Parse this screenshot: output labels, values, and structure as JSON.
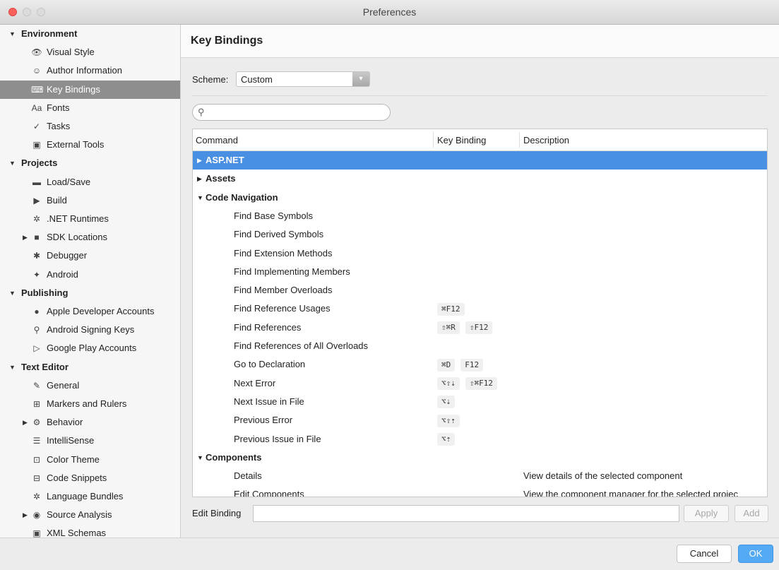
{
  "window": {
    "title": "Preferences"
  },
  "sidebar": {
    "groups": [
      {
        "label": "Environment",
        "items": [
          {
            "label": "Visual Style",
            "icon": "eye-icon",
            "glyph": "👁"
          },
          {
            "label": "Author Information",
            "icon": "smiley-icon",
            "glyph": "☺"
          },
          {
            "label": "Key Bindings",
            "icon": "keyboard-icon",
            "glyph": "⌨",
            "selected": true
          },
          {
            "label": "Fonts",
            "icon": "fonts-icon",
            "glyph": "Aa"
          },
          {
            "label": "Tasks",
            "icon": "checkmark-icon",
            "glyph": "✓"
          },
          {
            "label": "External Tools",
            "icon": "terminal-icon",
            "glyph": "▣"
          }
        ]
      },
      {
        "label": "Projects",
        "items": [
          {
            "label": "Load/Save",
            "icon": "drive-icon",
            "glyph": "▬"
          },
          {
            "label": "Build",
            "icon": "build-icon",
            "glyph": "▶"
          },
          {
            "label": ".NET Runtimes",
            "icon": "gear-icon",
            "glyph": "✲"
          },
          {
            "label": "SDK Locations",
            "icon": "folder-icon",
            "glyph": "■",
            "expandable": true
          },
          {
            "label": "Debugger",
            "icon": "bug-icon",
            "glyph": "✱"
          },
          {
            "label": "Android",
            "icon": "android-icon",
            "glyph": "✦"
          }
        ]
      },
      {
        "label": "Publishing",
        "items": [
          {
            "label": "Apple Developer Accounts",
            "icon": "apple-icon",
            "glyph": "●"
          },
          {
            "label": "Android Signing Keys",
            "icon": "key-search-icon",
            "glyph": "⚲"
          },
          {
            "label": "Google Play Accounts",
            "icon": "play-icon",
            "glyph": "▷"
          }
        ]
      },
      {
        "label": "Text Editor",
        "items": [
          {
            "label": "General",
            "icon": "edit-icon",
            "glyph": "✎"
          },
          {
            "label": "Markers and Rulers",
            "icon": "grid-icon",
            "glyph": "⊞"
          },
          {
            "label": "Behavior",
            "icon": "behavior-gear-icon",
            "glyph": "⚙",
            "expandable": true
          },
          {
            "label": "IntelliSense",
            "icon": "list-icon",
            "glyph": "☰"
          },
          {
            "label": "Color Theme",
            "icon": "palette-icon",
            "glyph": "⊡"
          },
          {
            "label": "Code Snippets",
            "icon": "snippet-icon",
            "glyph": "⊟"
          },
          {
            "label": "Language Bundles",
            "icon": "bundle-gear-icon",
            "glyph": "✲"
          },
          {
            "label": "Source Analysis",
            "icon": "radio-icon",
            "glyph": "◉",
            "expandable": true
          },
          {
            "label": "XML Schemas",
            "icon": "xml-icon",
            "glyph": "▣"
          }
        ]
      }
    ]
  },
  "main": {
    "title": "Key Bindings",
    "scheme_label": "Scheme:",
    "scheme_value": "Custom",
    "table": {
      "columns": [
        "Command",
        "Key Binding",
        "Description"
      ],
      "rows": [
        {
          "type": "group",
          "label": "ASP.NET",
          "expanded": false,
          "selected": true
        },
        {
          "type": "group",
          "label": "Assets",
          "expanded": false
        },
        {
          "type": "group",
          "label": "Code Navigation",
          "expanded": true
        },
        {
          "type": "child",
          "label": "Find Base Symbols",
          "keys": []
        },
        {
          "type": "child",
          "label": "Find Derived Symbols",
          "keys": []
        },
        {
          "type": "child",
          "label": "Find Extension Methods",
          "keys": []
        },
        {
          "type": "child",
          "label": "Find Implementing Members",
          "keys": []
        },
        {
          "type": "child",
          "label": "Find Member Overloads",
          "keys": []
        },
        {
          "type": "child",
          "label": "Find Reference Usages",
          "keys": [
            "⌘F12"
          ]
        },
        {
          "type": "child",
          "label": "Find References",
          "keys": [
            "⇧⌘R",
            "⇧F12"
          ]
        },
        {
          "type": "child",
          "label": "Find References of All Overloads",
          "keys": []
        },
        {
          "type": "child",
          "label": "Go to Declaration",
          "keys": [
            "⌘D",
            "F12"
          ]
        },
        {
          "type": "child",
          "label": "Next Error",
          "keys": [
            "⌥⇧⇣",
            "⇧⌘F12"
          ]
        },
        {
          "type": "child",
          "label": "Next Issue in File",
          "keys": [
            "⌥⇣"
          ]
        },
        {
          "type": "child",
          "label": "Previous Error",
          "keys": [
            "⌥⇧⇡"
          ]
        },
        {
          "type": "child",
          "label": "Previous Issue in File",
          "keys": [
            "⌥⇡"
          ]
        },
        {
          "type": "group",
          "label": "Components",
          "expanded": true
        },
        {
          "type": "child",
          "label": "Details",
          "keys": [],
          "description": "View details of the selected component"
        },
        {
          "type": "child",
          "label": "Edit Components",
          "keys": [],
          "description": "View the component manager for the selected projec"
        }
      ]
    },
    "edit_binding_label": "Edit Binding",
    "apply_label": "Apply",
    "add_label": "Add"
  },
  "footer": {
    "cancel_label": "Cancel",
    "ok_label": "OK"
  },
  "colors": {
    "selection": "#4a90e2",
    "ok_button": "#55aaf5",
    "sidebar_selected": "#8e8e8e"
  }
}
